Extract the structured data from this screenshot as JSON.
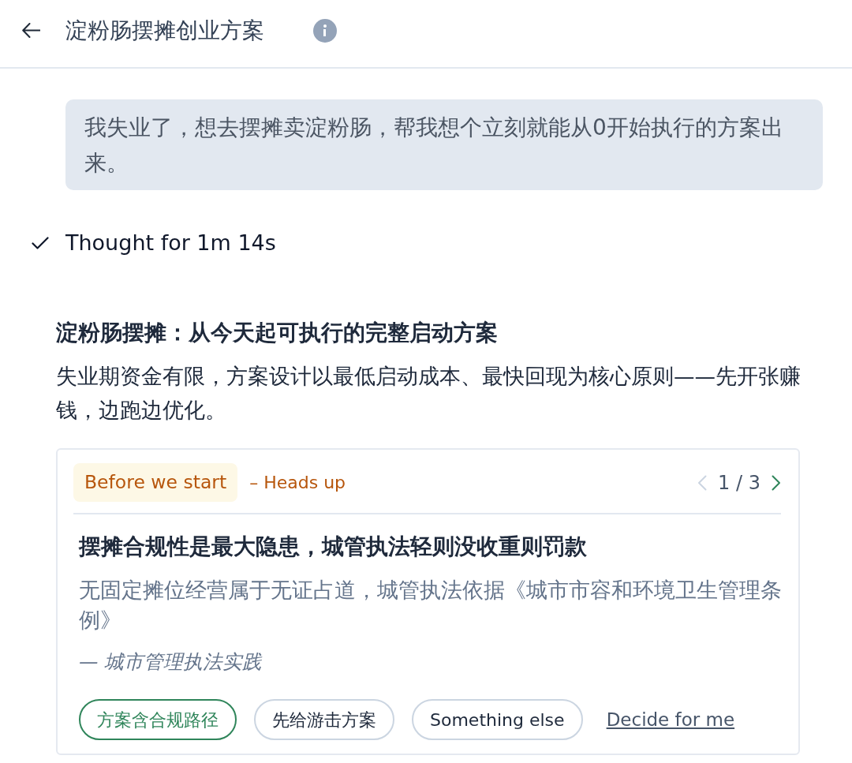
{
  "header": {
    "title": "淀粉肠摆摊创业方案"
  },
  "user_message": {
    "text": "我失业了，想去摆摊卖淀粉肠，帮我想个立刻就能从0开始执行的方案出来。"
  },
  "thinking": {
    "label": "Thought for 1m 14s"
  },
  "answer": {
    "heading": "淀粉肠摆摊：从今天起可执行的完整启动方案",
    "intro": "失业期资金有限，方案设计以最低启动成本、最快回现为核心原则——先开张赚钱，边跑边优化。"
  },
  "card": {
    "tag": "Before we start",
    "subtitle": "– Heads up",
    "pager": {
      "text": "1 / 3",
      "prev_disabled": true,
      "next_disabled": false
    },
    "title": "摆摊合规性是最大隐患，城管执法轻则没收重则罚款",
    "body": "无固定摊位经营属于无证占道，城管执法依据《城市市容和环境卫生管理条例》",
    "source": "— 城市管理执法实践",
    "options": [
      {
        "kind": "chip",
        "label": "方案含合规路径",
        "selected": true
      },
      {
        "kind": "chip",
        "label": "先给游击方案",
        "selected": false
      },
      {
        "kind": "chip",
        "label": "Something else",
        "selected": false
      },
      {
        "kind": "link",
        "label": "Decide for me",
        "selected": false
      }
    ]
  }
}
